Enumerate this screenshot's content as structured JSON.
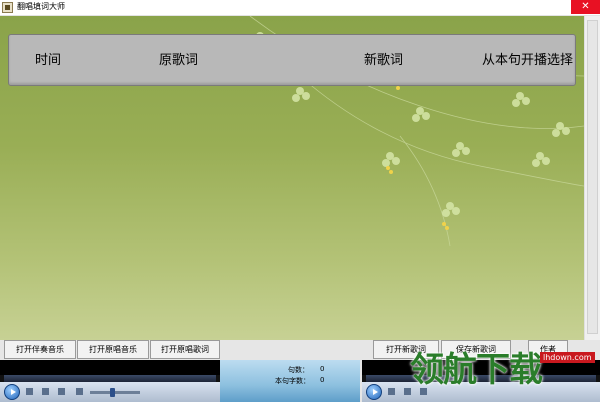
{
  "window": {
    "title": "翻唱填词大师",
    "close_label": "✕"
  },
  "lyric_header": {
    "time": "时间",
    "original": "原歌词",
    "new": "新歌词",
    "start_from": "从本句开播选择"
  },
  "buttons": {
    "open_accompaniment": "打开伴奏音乐",
    "open_original_music": "打开原唱音乐",
    "open_original_lyrics": "打开原唱歌词",
    "open_new_lyrics": "打开新歌词",
    "save_new_lyrics": "保存新歌词",
    "author": "作者"
  },
  "info": {
    "sentence_label": "句数：",
    "sentence_value": "0",
    "char_label": "本句字数：",
    "char_value": "0"
  },
  "watermark": {
    "text": "领航下载",
    "url": "lhdown.com"
  }
}
